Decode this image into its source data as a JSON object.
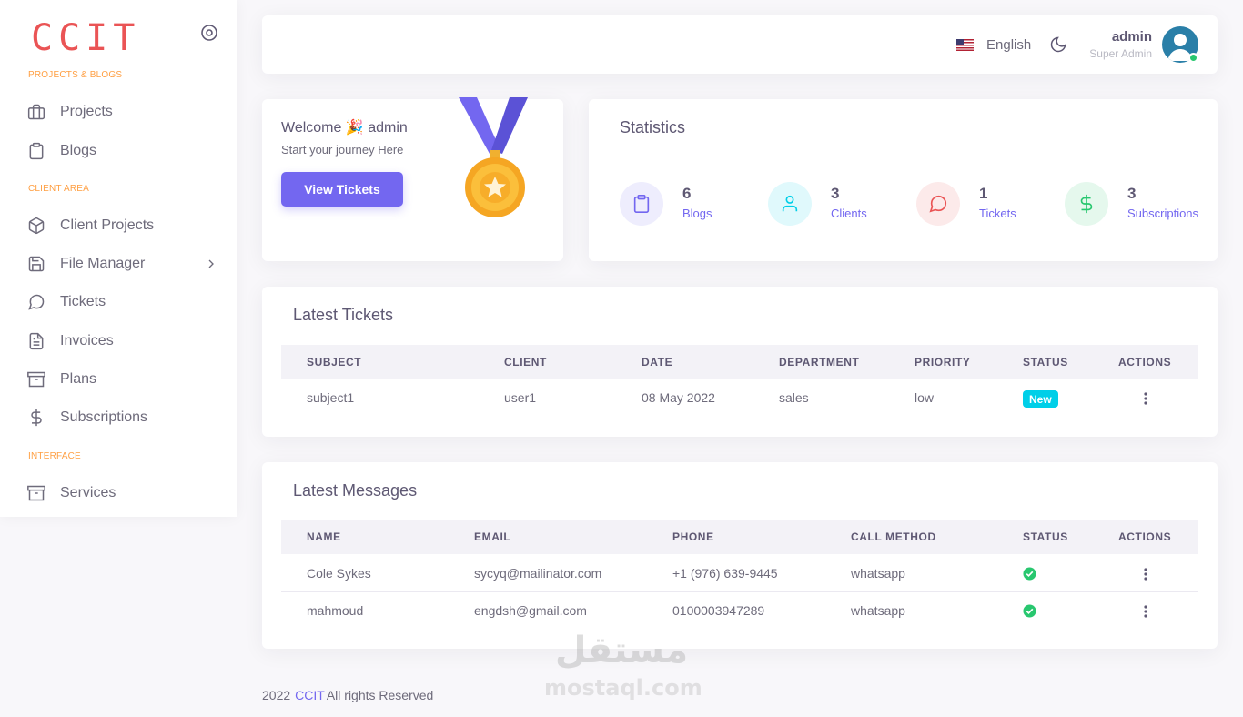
{
  "sidebar": {
    "logo": "CCIT",
    "sections": [
      {
        "header": "PROJECTS & BLOGS",
        "items": [
          {
            "label": "Projects",
            "icon": "briefcase-icon"
          },
          {
            "label": "Blogs",
            "icon": "clipboard-icon"
          }
        ]
      },
      {
        "header": "CLIENT AREA",
        "items": [
          {
            "label": "Client Projects",
            "icon": "box-icon"
          },
          {
            "label": "File Manager",
            "icon": "save-icon"
          },
          {
            "label": "Tickets",
            "icon": "message-circle-icon"
          },
          {
            "label": "Invoices",
            "icon": "file-text-icon"
          },
          {
            "label": "Plans",
            "icon": "archive-icon"
          },
          {
            "label": "Subscriptions",
            "icon": "dollar-icon"
          }
        ]
      },
      {
        "header": "INTERFACE",
        "items": [
          {
            "label": "Services",
            "icon": "archive-icon"
          }
        ]
      }
    ]
  },
  "navbar": {
    "language": "English",
    "user_name": "admin",
    "user_role": "Super Admin"
  },
  "welcome": {
    "title": "Welcome 🎉 admin",
    "subtitle": "Start your journey Here",
    "button": "View Tickets"
  },
  "statistics": {
    "title": "Statistics",
    "items": [
      {
        "value": "6",
        "label": "Blogs",
        "icon": "clipboard-icon",
        "color": "#7367f0",
        "bg": "#eeedfd"
      },
      {
        "value": "3",
        "label": "Clients",
        "icon": "user-icon",
        "color": "#00cfe8",
        "bg": "#e0f9fc"
      },
      {
        "value": "1",
        "label": "Tickets",
        "icon": "message-circle-icon",
        "color": "#ea5455",
        "bg": "#fceaea"
      },
      {
        "value": "3",
        "label": "Subscriptions",
        "icon": "dollar-icon",
        "color": "#28c76f",
        "bg": "#e5f8ed"
      }
    ]
  },
  "tickets": {
    "title": "Latest Tickets",
    "columns": [
      "SUBJECT",
      "CLIENT",
      "DATE",
      "DEPARTMENT",
      "PRIORITY",
      "STATUS",
      "ACTIONS"
    ],
    "rows": [
      {
        "subject": "subject1",
        "client": "user1",
        "date": "08 May 2022",
        "department": "sales",
        "priority": "low",
        "status": "New"
      }
    ]
  },
  "messages": {
    "title": "Latest Messages",
    "columns": [
      "NAME",
      "EMAIL",
      "PHONE",
      "CALL METHOD",
      "STATUS",
      "ACTIONS"
    ],
    "rows": [
      {
        "name": "Cole Sykes",
        "email": "sycyq@mailinator.com",
        "phone": "+1 (976) 639-9445",
        "method": "whatsapp"
      },
      {
        "name": "mahmoud",
        "email": "engdsh@gmail.com",
        "phone": "0100003947289",
        "method": "whatsapp"
      }
    ]
  },
  "footer": {
    "year": "2022",
    "brand": "CCIT",
    "text": "All rights Reserved"
  },
  "watermark": {
    "arabic": "مستقل",
    "latin": "mostaql.com"
  },
  "colors": {
    "primary": "#7367f0",
    "logo": "#ea5455",
    "section_header": "#ff9f43",
    "success": "#28c76f",
    "info": "#00cfe8"
  }
}
